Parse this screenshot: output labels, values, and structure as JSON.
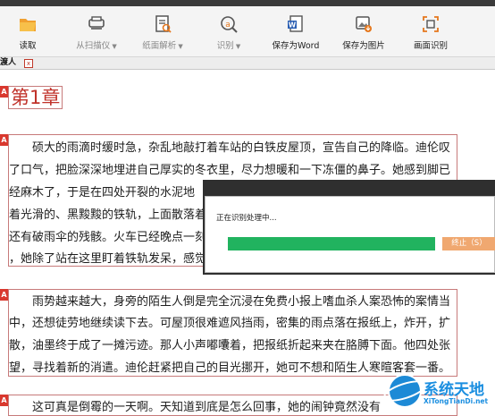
{
  "toolbar": {
    "items": [
      {
        "label": "读取",
        "icon": "folder-open-icon"
      },
      {
        "label": "从扫描仪",
        "icon": "scanner-icon"
      },
      {
        "label": "纸面解析",
        "icon": "document-parse-icon"
      },
      {
        "label": "识别",
        "icon": "recognize-icon"
      },
      {
        "label": "保存为Word",
        "icon": "word-file-icon"
      },
      {
        "label": "保存为图片",
        "icon": "image-save-icon"
      },
      {
        "label": "画面识别",
        "icon": "screen-capture-icon"
      }
    ]
  },
  "tab": {
    "title": "渡人",
    "close": "x"
  },
  "document": {
    "badge": "A",
    "chapter_title": "第1章",
    "paragraphs": [
      {
        "lines": [
          "硕大的雨滴时缓时急，杂乱地敲打着车站的白铁皮屋顶，宣告自己的降临。迪伦叹",
          "了口气，把脸深深地埋进自己厚实的冬衣里，尽力想暖和一下冻僵的鼻子。她感到脚已",
          "经麻木了，于是在四处开裂的水泥地",
          "着光滑的、黑黢黢的铁轨，上面散落着",
          "还有破雨伞的残骸。火车已经晚点一刻",
          "，她除了站在这里盯着铁轨发呆，感觉"
        ]
      },
      {
        "lines": [
          "雨势越来越大，身旁的陌生人倒是完全沉浸在免费小报上嗜血杀人案恐怖的案情当",
          "中，还想徒劳地继续读下去。可屋顶很难遮风挡雨，密集的雨点落在报纸上，炸开，扩",
          "散，油墨终于成了一摊污迹。那人小声嘟囔着，把报纸折起来夹在胳膊下面。他四处张",
          "望，寻找着新的消遣。迪伦赶紧把自己的目光挪开，她可不想和陌生人寒暄客套一番。"
        ]
      },
      {
        "lines": [
          "这可真是倒霉的一天啊。天知道到底是怎么回事，她的闹钟竟然没有"
        ]
      }
    ]
  },
  "dialog": {
    "title": "正在识别处理中...",
    "progress": 1.0,
    "stop_label": "终止（S）"
  },
  "watermark": {
    "name": "系统天地",
    "site": "XiTongTianDi.net"
  },
  "colors": {
    "accent_red": "#d9382e",
    "progress_green": "#21b35f",
    "stop_orange": "#f0a870",
    "watermark_blue": "#1a8ee0"
  }
}
